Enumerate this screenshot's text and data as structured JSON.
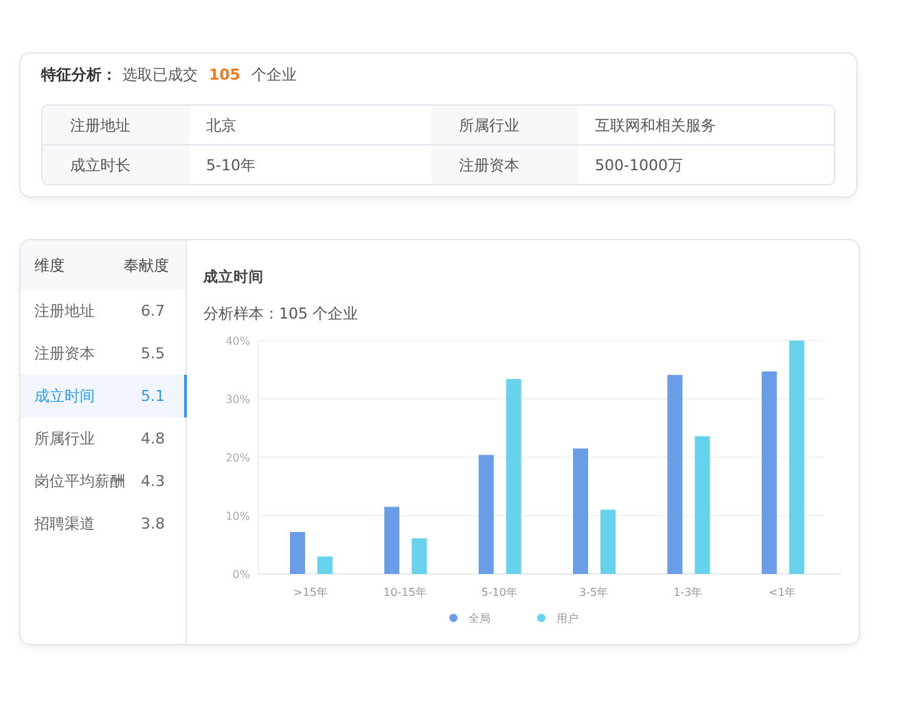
{
  "feature": {
    "title": "特征分析：",
    "prefix": "选取已成交",
    "count": "105",
    "suffix": "个企业",
    "rows": [
      [
        {
          "label": "注册地址",
          "value": "北京"
        },
        {
          "label": "所属行业",
          "value": "互联网和相关服务"
        }
      ],
      [
        {
          "label": "成立时长",
          "value": "5-10年"
        },
        {
          "label": "注册资本",
          "value": "500-1000万"
        }
      ]
    ]
  },
  "dimensions": {
    "header": {
      "name": "维度",
      "score": "奉献度"
    },
    "items": [
      {
        "name": "注册地址",
        "score": "6.7",
        "selected": false
      },
      {
        "name": "注册资本",
        "score": "5.5",
        "selected": false
      },
      {
        "name": "成立时间",
        "score": "5.1",
        "selected": true
      },
      {
        "name": "所属行业",
        "score": "4.8",
        "selected": false
      },
      {
        "name": "岗位平均薪酬",
        "score": "4.3",
        "selected": false
      },
      {
        "name": "招聘渠道",
        "score": "3.8",
        "selected": false
      }
    ]
  },
  "detail": {
    "title": "成立时间",
    "sample": "分析样本：105 个企业",
    "chart_data": {
      "type": "bar",
      "categories": [
        ">15年",
        "10-15年",
        "5-10年",
        "3-5年",
        "1-3年",
        "<1年"
      ],
      "series": [
        {
          "name": "全局",
          "color": "#6a9de8",
          "values": [
            7.2,
            11.5,
            20.4,
            21.5,
            34.1,
            34.7
          ]
        },
        {
          "name": "用户",
          "color": "#66d2ee",
          "values": [
            3.0,
            6.1,
            33.4,
            11.0,
            23.6,
            40
          ]
        }
      ],
      "ylim": [
        0,
        40
      ],
      "grid": true,
      "legend": true,
      "yticks": [
        {
          "value": 0,
          "label": "0%"
        },
        {
          "value": 10,
          "label": "10%"
        },
        {
          "value": 20,
          "label": "20%"
        },
        {
          "value": 30,
          "label": "30%"
        },
        {
          "value": 40,
          "label": "40%"
        }
      ]
    }
  }
}
